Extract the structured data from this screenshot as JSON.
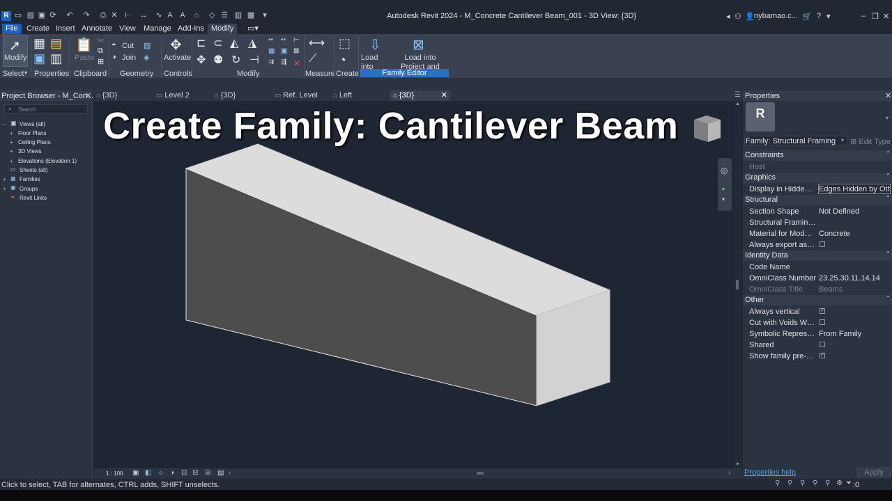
{
  "titlebar": {
    "app_logo": "R",
    "window_title": "Autodesk Revit 2024 - M_Concrete Cantilever Beam_001 - 3D View: {3D}",
    "user": "nybamao.c...",
    "help": "?"
  },
  "menu": {
    "tabs": [
      "File",
      "Create",
      "Insert",
      "Annotate",
      "View",
      "Manage",
      "Add-Ins",
      "Modify"
    ],
    "active": "Modify"
  },
  "ribbon": {
    "modify_label": "Modify",
    "select_label": "Select",
    "paste_label": "Paste",
    "cut_label": "Cut",
    "join_label": "Join",
    "activate_label": "Activate",
    "load_into_project": "Load into Project",
    "load_into_project_close": "Load into Project and Close",
    "panels": {
      "properties": "Properties",
      "clipboard": "Clipboard",
      "geometry": "Geometry",
      "controls": "Controls",
      "modify": "Modify",
      "measure": "Measure",
      "create": "Create",
      "family_editor": "Family Editor"
    }
  },
  "project_browser": {
    "title": "Project Browser - M_Con...",
    "search_placeholder": "Search",
    "items": [
      {
        "label": "Views (all)",
        "toggle": "−"
      },
      {
        "label": "Floor Plans",
        "toggle": "+"
      },
      {
        "label": "Ceiling Plans",
        "toggle": "+"
      },
      {
        "label": "3D Views",
        "toggle": "+"
      },
      {
        "label": "Elevations (Elevation 1)",
        "toggle": "+"
      },
      {
        "label": "Sheets (all)",
        "toggle": ""
      },
      {
        "label": "Families",
        "toggle": "+"
      },
      {
        "label": "Groups",
        "toggle": "+"
      },
      {
        "label": "Revit Links",
        "toggle": ""
      }
    ]
  },
  "view_tabs": [
    "{3D}",
    "Level 2",
    "{3D}",
    "Ref. Level",
    "Left",
    "{3D}"
  ],
  "canvas": {
    "headline": "Create Family: Cantilever Beam",
    "scale": "1 : 100"
  },
  "properties": {
    "title": "Properties",
    "family_type": "Family: Structural Framing",
    "edit_type": "Edit Type",
    "sections": {
      "constraints": "Constraints",
      "graphics": "Graphics",
      "structural": "Structural",
      "identity": "Identity Data",
      "other": "Other"
    },
    "rows": {
      "host": "Host",
      "display_hidden_name": "Display in Hidden Vi...",
      "display_hidden_value": "Edges Hidden by Oth",
      "section_shape_name": "Section Shape",
      "section_shape_value": "Not Defined",
      "framing_name": "Structural Framing L...",
      "material_name": "Material for Model B...",
      "material_value": "Concrete",
      "export_name": "Always export as ge...",
      "code_name": "Code Name",
      "omniclass_number_name": "OmniClass Number",
      "omniclass_number_value": "23.25.30.11.14.14",
      "omniclass_title_name": "OmniClass Title",
      "omniclass_title_value": "Beams",
      "always_vertical": "Always vertical",
      "cut_voids": "Cut with Voids When...",
      "symbolic_name": "Symbolic Represent...",
      "symbolic_value": "From Family",
      "shared": "Shared",
      "show_precut": "Show family pre-cut ..."
    },
    "help_link": "Properties help",
    "apply": "Apply"
  },
  "status": {
    "text": "Click to select, TAB for alternates, CTRL adds, SHIFT unselects.",
    "filter_count": ":0"
  }
}
